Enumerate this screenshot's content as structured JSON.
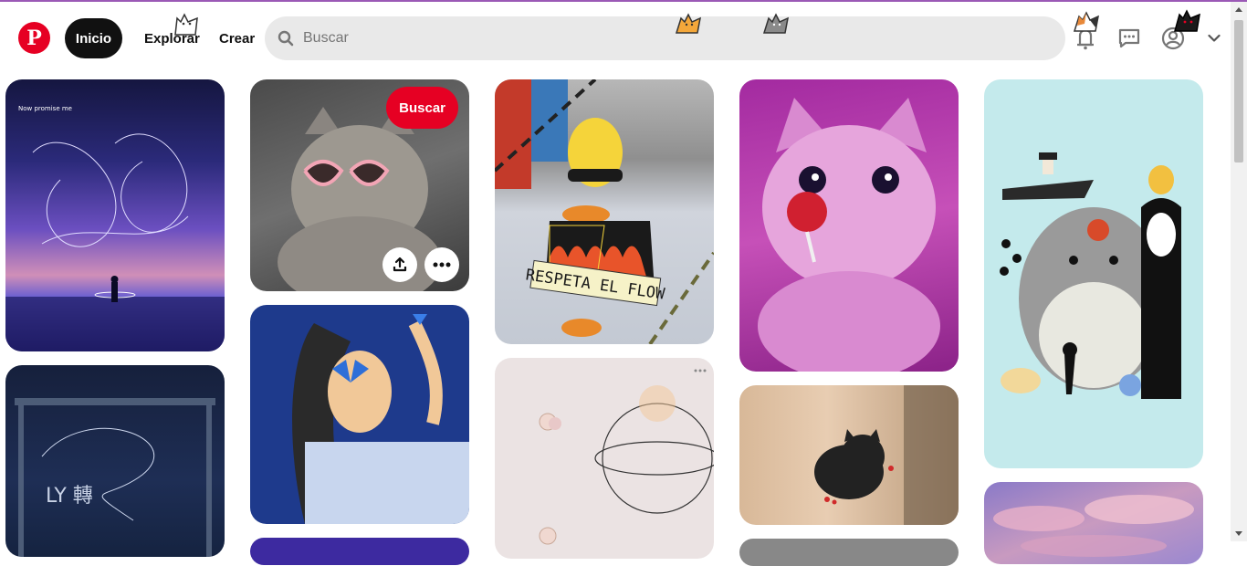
{
  "header": {
    "logo_letter": "P",
    "nav": {
      "home": "Inicio",
      "explore": "Explorar",
      "create": "Crear"
    },
    "search": {
      "placeholder": "Buscar",
      "value": ""
    }
  },
  "pins": [
    {
      "caption": "Now promise me"
    },
    {
      "caption": "LY 轉"
    },
    {
      "save_label": "Buscar"
    },
    {
      "caption": ""
    },
    {
      "caption": "RESPETA EL FLOW"
    },
    {
      "caption": ""
    }
  ],
  "colors": {
    "brand": "#e60023",
    "pill": "#111111",
    "search_bg": "#e9e9e9"
  }
}
